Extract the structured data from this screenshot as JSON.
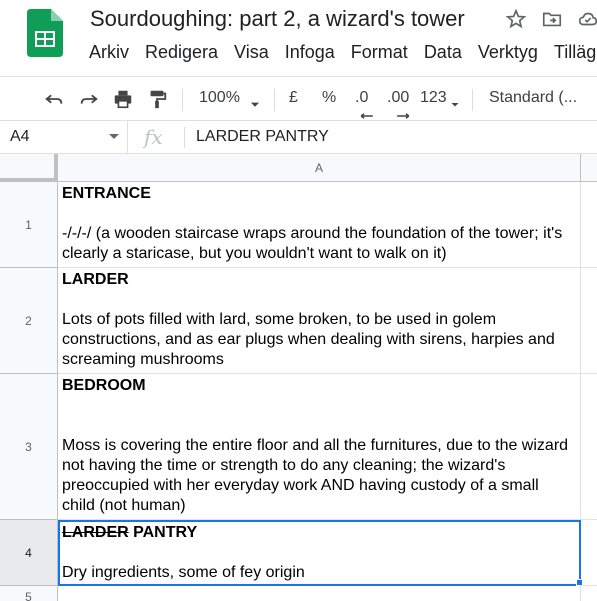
{
  "app": {
    "title": "Sourdoughing: part 2, a wizard's tower",
    "logo_icon": "google-sheets-icon",
    "accent": "#0f9d58"
  },
  "menu": [
    "Arkiv",
    "Redigera",
    "Visa",
    "Infoga",
    "Format",
    "Data",
    "Verktyg",
    "Tilläg"
  ],
  "toolbar": {
    "zoom": "100%",
    "currency": "£",
    "percent": "%",
    "decrease_decimals": ".0",
    "increase_decimals": ".00",
    "more_formats": "123",
    "font": "Standard (..."
  },
  "formula_bar": {
    "cell_ref": "A4",
    "fx": "fx",
    "value": "LARDER PANTRY"
  },
  "sheet": {
    "column_header": "A",
    "rows": [
      {
        "num": "1",
        "title": "ENTRANCE",
        "body": "-/-/-/ (a wooden staircase wraps around the foundation of the tower; it's clearly a staricase, but you wouldn't want to walk on it)"
      },
      {
        "num": "2",
        "title": "LARDER",
        "body": "Lots of pots filled with lard, some broken, to be used in golem constructions, and as ear plugs when dealing with sirens, harpies and screaming mushrooms"
      },
      {
        "num": "3",
        "title": "BEDROOM",
        "body": "Moss is covering the entire floor and all the furnitures, due to the wizard not having the time or strength to do any cleaning; the wizard's preoccupied with her everyday work AND having custody of a small child (not human)"
      },
      {
        "num": "4",
        "title_struck": "LARDER",
        "title_rest": " PANTRY",
        "body": "Dry ingredients, some of fey origin"
      },
      {
        "num": "5"
      }
    ]
  },
  "colors": {
    "selection": "#1a73e8",
    "header_bg": "#f8f9fa"
  }
}
